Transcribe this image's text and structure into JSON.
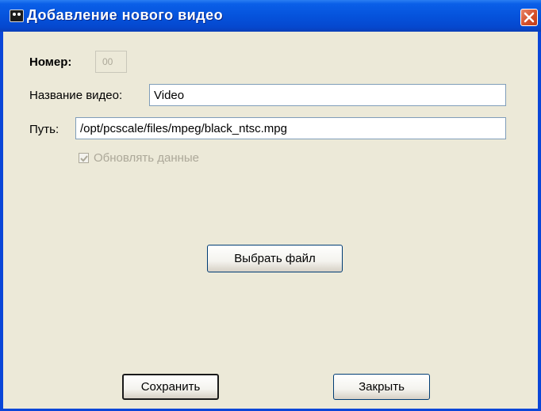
{
  "window": {
    "title": "Добавление нового видео",
    "close_icon": "close-x-icon",
    "app_icon": "app-icon"
  },
  "form": {
    "number_label": "Номер:",
    "number_value": "00",
    "video_name_label": "Название видео:",
    "video_name_value": "Video",
    "path_label": "Путь:",
    "path_value": "/opt/pcscale/files/mpeg/black_ntsc.mpg",
    "update_data_label": "Обновлять данные",
    "update_data_checked": true
  },
  "buttons": {
    "choose_file": "Выбрать файл",
    "save": "Сохранить",
    "close": "Закрыть"
  },
  "colors": {
    "title_bar": "#0553dc",
    "dialog_bg": "#ece9d8",
    "close_button": "#d4502b"
  }
}
